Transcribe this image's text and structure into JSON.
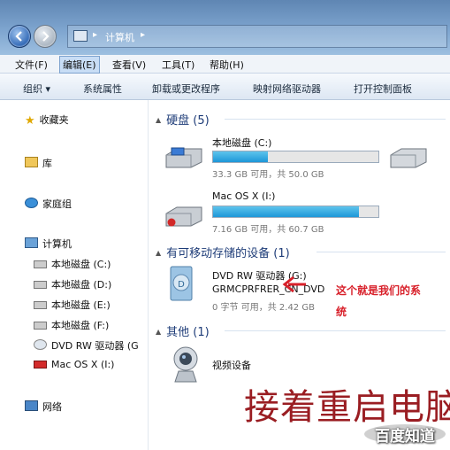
{
  "address": {
    "path_label": "计算机",
    "separators": [
      "▸",
      "▸"
    ]
  },
  "menubar": {
    "items": [
      "文件(F)",
      "编辑(E)",
      "查看(V)",
      "工具(T)",
      "帮助(H)"
    ],
    "active": "编辑(E)"
  },
  "commandbar": {
    "items": [
      "组织 ▾",
      "系统属性",
      "卸载或更改程序",
      "映射网络驱动器",
      "打开控制面板"
    ]
  },
  "sidebar": {
    "items": [
      {
        "label": "收藏夹",
        "icon": "star-icon"
      },
      {
        "label": "库",
        "icon": "library-icon"
      },
      {
        "label": "家庭组",
        "icon": "homegroup-icon"
      },
      {
        "label": "计算机",
        "icon": "computer-icon"
      },
      {
        "label": "本地磁盘 (C:)",
        "icon": "drive-icon"
      },
      {
        "label": "本地磁盘 (D:)",
        "icon": "drive-icon"
      },
      {
        "label": "本地磁盘 (E:)",
        "icon": "drive-icon"
      },
      {
        "label": "本地磁盘 (F:)",
        "icon": "drive-icon"
      },
      {
        "label": "DVD RW 驱动器 (G",
        "icon": "dvd-icon"
      },
      {
        "label": "Mac OS X (I:)",
        "icon": "mac-drive-icon"
      },
      {
        "label": "网络",
        "icon": "network-icon"
      }
    ]
  },
  "groups": {
    "hard_disks": {
      "title": "硬盘 (5)"
    },
    "removable": {
      "title": "有可移动存储的设备 (1)"
    },
    "other": {
      "title": "其他 (1)"
    }
  },
  "drives": [
    {
      "name": "本地磁盘 (C:)",
      "info": "33.3 GB 可用，共 50.0 GB",
      "used_fraction": 0.33
    },
    {
      "name": "Mac OS X (I:)",
      "info": "7.16 GB 可用，共 60.7 GB",
      "used_fraction": 0.88
    }
  ],
  "dvd": {
    "name": "DVD RW 驱动器 (G:)",
    "label": "GRMCPRFRER_CN_DVD",
    "info": "0 字节 可用，共 2.42 GB"
  },
  "other_device": {
    "name": "视频设备"
  },
  "annotation": {
    "line1": "这个就是我们的系",
    "line2": "统"
  },
  "overlay_text": "接着重启电脑",
  "watermark": "百度知道",
  "colors": {
    "bar_fill": "#1d97d8",
    "annotation": "#d8202a",
    "overlay": "#9a1d22"
  }
}
